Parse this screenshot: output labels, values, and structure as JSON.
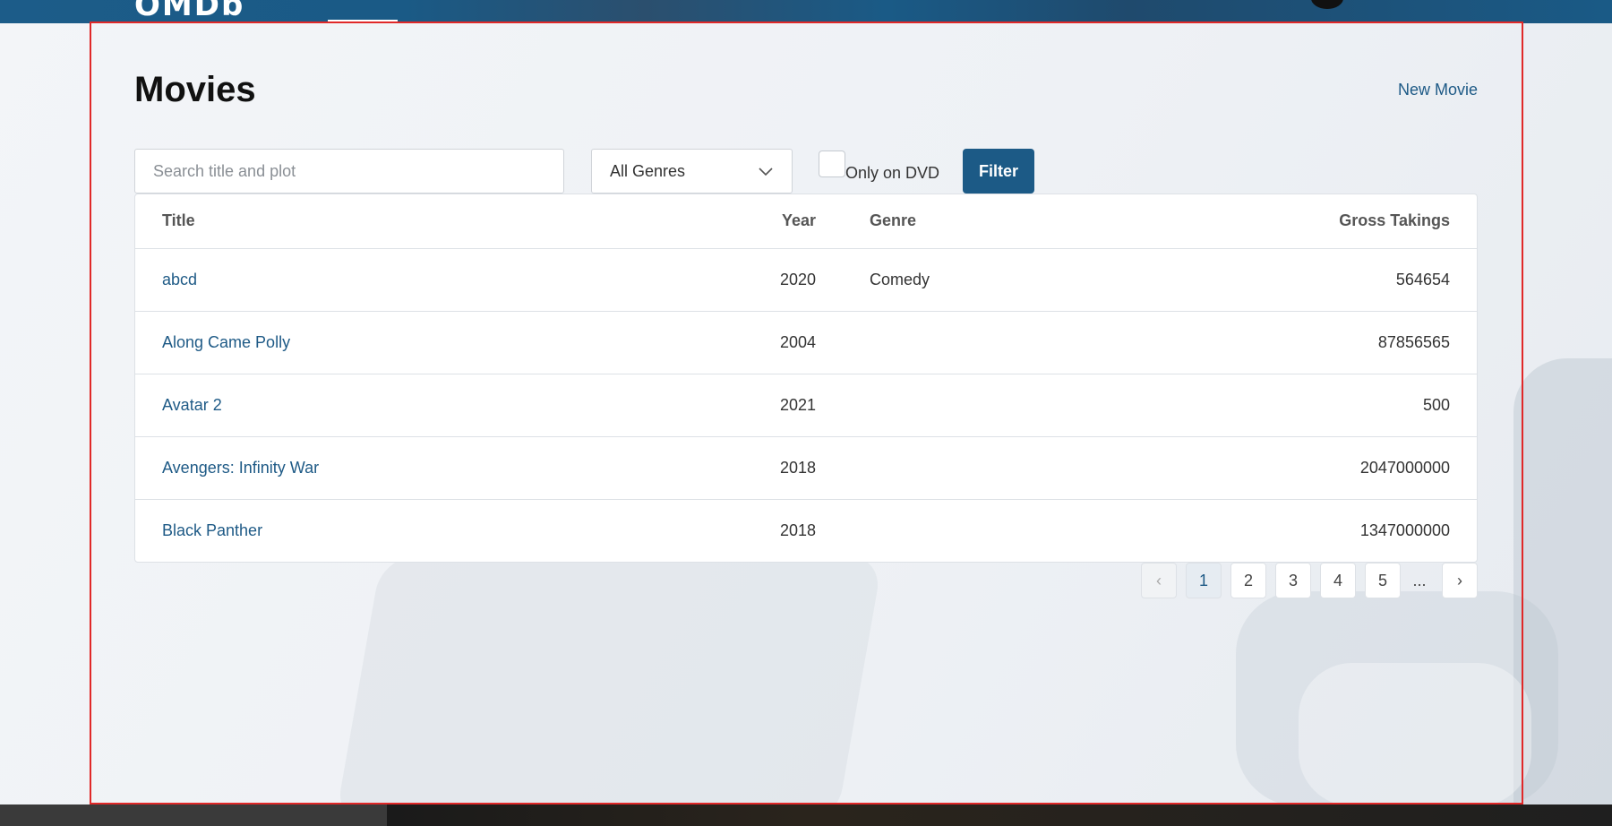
{
  "nav": {
    "logo_text": "OMDb"
  },
  "page": {
    "title": "Movies",
    "new_movie_label": "New Movie"
  },
  "filters": {
    "search_placeholder": "Search title and plot",
    "search_value": "",
    "genre_selected": "All Genres",
    "dvd_label": "Only on DVD",
    "dvd_checked": false,
    "filter_label": "Filter"
  },
  "table": {
    "headers": {
      "title": "Title",
      "year": "Year",
      "genre": "Genre",
      "gross": "Gross Takings"
    },
    "rows": [
      {
        "title": "abcd",
        "year": "2020",
        "genre": "Comedy",
        "gross": "564654"
      },
      {
        "title": "Along Came Polly",
        "year": "2004",
        "genre": "",
        "gross": "87856565"
      },
      {
        "title": "Avatar 2",
        "year": "2021",
        "genre": "",
        "gross": "500"
      },
      {
        "title": "Avengers: Infinity War",
        "year": "2018",
        "genre": "",
        "gross": "2047000000"
      },
      {
        "title": "Black Panther",
        "year": "2018",
        "genre": "",
        "gross": "1347000000"
      }
    ]
  },
  "pagination": {
    "prev_icon": "‹",
    "pages": [
      "1",
      "2",
      "3",
      "4",
      "5"
    ],
    "current": "1",
    "ellipsis": "...",
    "next_icon": "›"
  },
  "colors": {
    "brand": "#1c5a86",
    "frame_outline": "#e02828"
  }
}
